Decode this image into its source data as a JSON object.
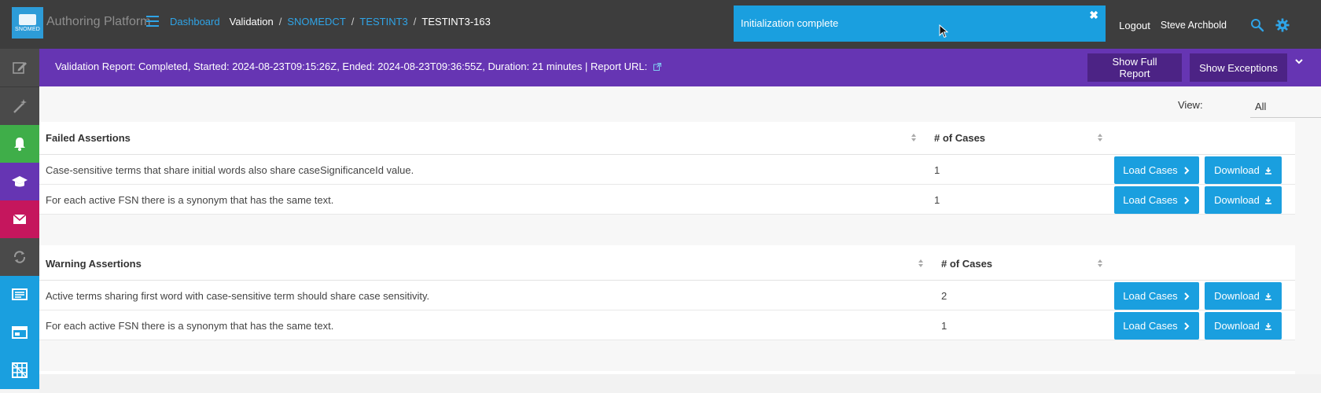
{
  "header": {
    "logo_text": "SNOMED",
    "app_title": "Authoring Platform",
    "breadcrumbs": [
      {
        "label": "Dashboard"
      },
      {
        "label": "Validation"
      },
      {
        "label": "SNOMEDCT"
      },
      {
        "label": "TESTINT3"
      },
      {
        "label": "TESTINT3-163"
      }
    ],
    "logout_label": "Logout",
    "user_name": "Steve Archbold",
    "icons": [
      "menu-icon",
      "search-icon",
      "gear-icon"
    ]
  },
  "toast": {
    "message": "Initialization complete",
    "close_glyph": "✖"
  },
  "sidebar": {
    "items": [
      {
        "icon": "edit-icon",
        "color": "#4a4a4a"
      },
      {
        "icon": "magic-wand-icon",
        "color": "#4a4a4a"
      },
      {
        "icon": "bell-icon",
        "color": "#3fae49"
      },
      {
        "icon": "graduation-cap-icon",
        "color": "#6635b3"
      },
      {
        "icon": "mail-icon",
        "color": "#c5165d"
      },
      {
        "icon": "sync-icon",
        "color": "#4a4a4a"
      },
      {
        "icon": "list-icon",
        "color": "#1a9fdf"
      },
      {
        "icon": "window-icon",
        "color": "#1a9fdf"
      },
      {
        "icon": "grid-icon",
        "color": "#1a9fdf"
      }
    ]
  },
  "banner": {
    "text": "Validation Report: Completed, Started: 2024-08-23T09:15:26Z, Ended: 2024-08-23T09:36:55Z, Duration: 21 minutes | Report URL:",
    "show_full_report_label": "Show Full Report",
    "show_exceptions_label": "Show Exceptions",
    "color": "#6635b3"
  },
  "view": {
    "label": "View:",
    "selected": "All"
  },
  "failed": {
    "title": "Failed Assertions",
    "cases_header": "# of Cases",
    "rows": [
      {
        "text": "Case-sensitive terms that share initial words also share caseSignificanceId value.",
        "cases": "1",
        "load_label": "Load Cases",
        "download_label": "Download"
      },
      {
        "text": "For each active FSN there is a synonym that has the same text.",
        "cases": "1",
        "load_label": "Load Cases",
        "download_label": "Download"
      }
    ]
  },
  "warning": {
    "title": "Warning Assertions",
    "cases_header": "# of Cases",
    "rows": [
      {
        "text": "Active terms sharing first word with case-sensitive term should share case sensitivity.",
        "cases": "2",
        "load_label": "Load Cases",
        "download_label": "Download"
      },
      {
        "text": "For each active FSN there is a synonym that has the same text.",
        "cases": "1",
        "load_label": "Load Cases",
        "download_label": "Download"
      }
    ]
  },
  "colors": {
    "accent_blue": "#1a9fdf",
    "topbar": "#3d3d3d",
    "purple_dark": "#4c2385"
  }
}
